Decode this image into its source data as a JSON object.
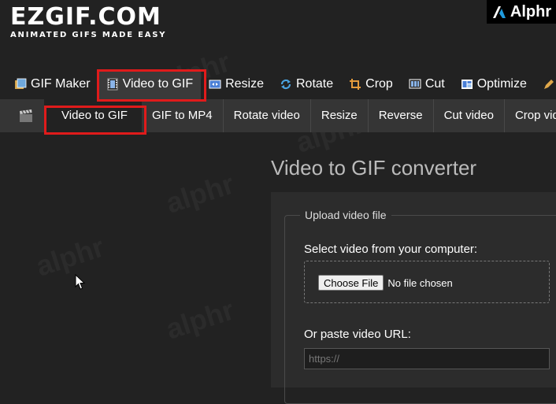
{
  "brand": {
    "logo_text": "EZGIF.COM",
    "tagline": "ANIMATED GIFS MADE EASY",
    "watermark_badge": "Alphr",
    "watermark_text": "alphr"
  },
  "main_nav": {
    "items": [
      {
        "label": "GIF Maker",
        "icon": "gif-maker-icon"
      },
      {
        "label": "Video to GIF",
        "icon": "film-icon"
      },
      {
        "label": "Resize",
        "icon": "resize-icon"
      },
      {
        "label": "Rotate",
        "icon": "rotate-icon"
      },
      {
        "label": "Crop",
        "icon": "crop-icon"
      },
      {
        "label": "Cut",
        "icon": "cut-icon"
      },
      {
        "label": "Optimize",
        "icon": "optimize-icon"
      }
    ],
    "active": "Video to GIF"
  },
  "sub_nav": {
    "icon": "clapperboard-icon",
    "tabs": [
      "Video to GIF",
      "GIF to MP4",
      "Rotate video",
      "Resize",
      "Reverse",
      "Cut video",
      "Crop video"
    ],
    "active": "Video to GIF"
  },
  "main": {
    "title": "Video to GIF converter",
    "upload": {
      "legend": "Upload video file",
      "select_label": "Select video from your computer:",
      "choose_button": "Choose File",
      "no_file": "No file chosen",
      "url_label": "Or paste video URL:",
      "url_placeholder": "https://",
      "url_value": ""
    }
  },
  "colors": {
    "background": "#222222",
    "subnav_background": "#353535",
    "highlight": "#e01b1b",
    "panel": "#2c2c2c"
  }
}
